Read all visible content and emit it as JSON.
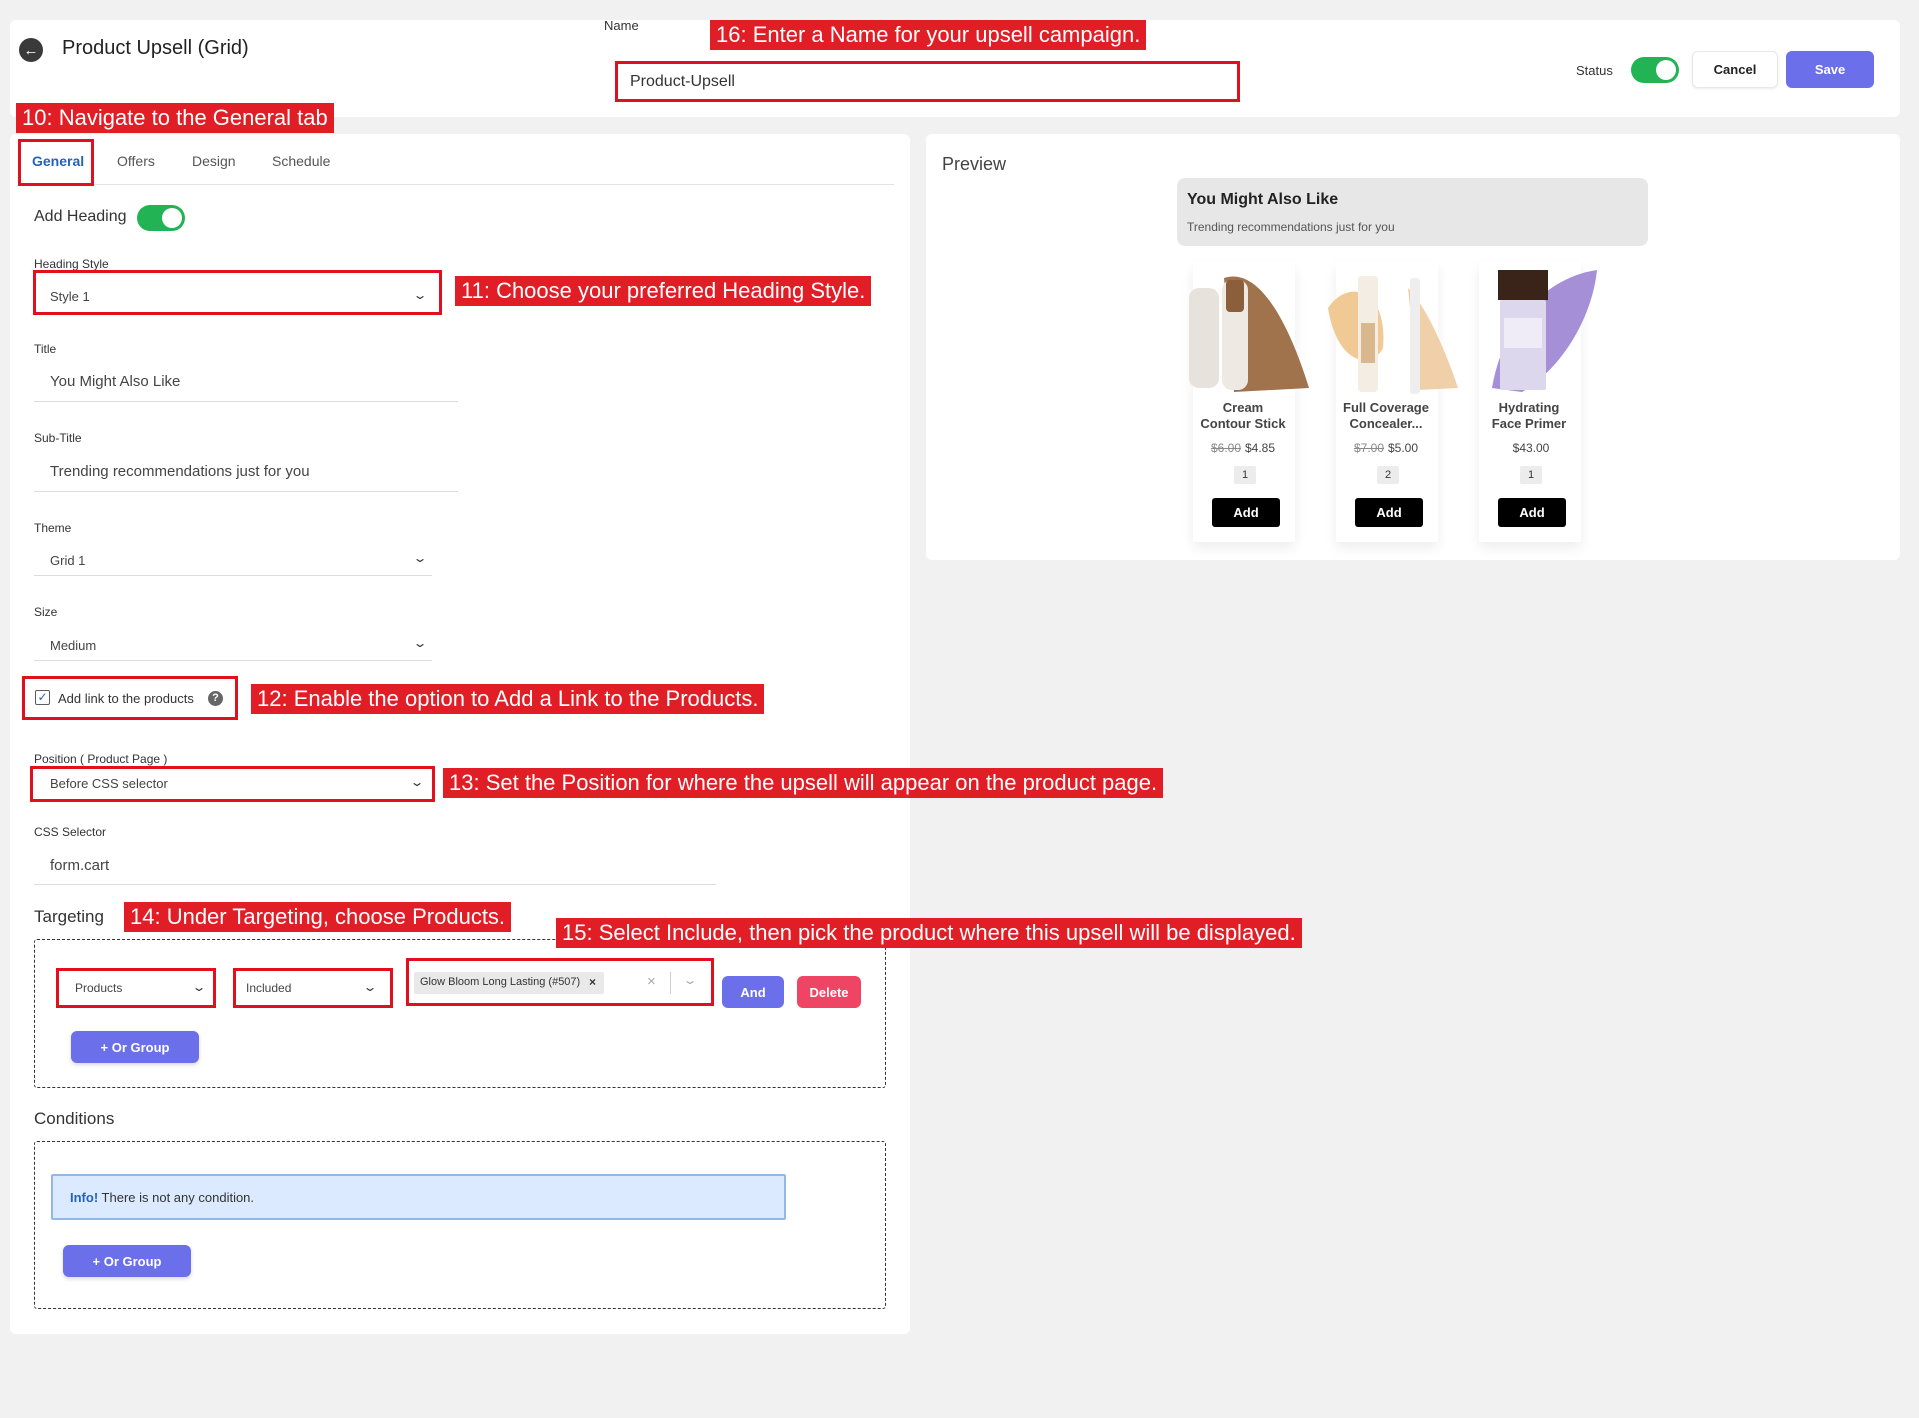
{
  "header": {
    "title": "Product Upsell (Grid)",
    "name_label": "Name",
    "name_value": "Product-Upsell",
    "status_label": "Status",
    "cancel": "Cancel",
    "save": "Save"
  },
  "tabs": [
    "General",
    "Offers",
    "Design",
    "Schedule"
  ],
  "general": {
    "add_heading_label": "Add Heading",
    "heading_style_label": "Heading Style",
    "heading_style_value": "Style 1",
    "title_label": "Title",
    "title_value": "You Might Also Like",
    "subtitle_label": "Sub-Title",
    "subtitle_value": "Trending recommendations just for you",
    "theme_label": "Theme",
    "theme_value": "Grid 1",
    "size_label": "Size",
    "size_value": "Medium",
    "add_link_label": "Add link to the products",
    "add_link_checked": true,
    "position_label": "Position ( Product Page )",
    "position_value": "Before CSS selector",
    "css_selector_label": "CSS Selector",
    "css_selector_value": "form.cart"
  },
  "targeting": {
    "title": "Targeting",
    "type_value": "Products",
    "mode_value": "Included",
    "selected_tag": "Glow Bloom Long Lasting (#507)",
    "and_button": "And",
    "delete_button": "Delete",
    "or_group_button": "+ Or Group"
  },
  "conditions": {
    "title": "Conditions",
    "info_bold": "Info!",
    "info_text": "There is not any condition.",
    "or_group_button": "+ Or Group"
  },
  "preview": {
    "label": "Preview",
    "heading_title": "You Might Also Like",
    "heading_subtitle": "Trending recommendations just for you",
    "products": [
      {
        "name_line1": "Cream",
        "name_line2": "Contour Stick",
        "old_price": "$6.00",
        "price": "$4.85",
        "qty": "1",
        "add": "Add"
      },
      {
        "name_line1": "Full Coverage",
        "name_line2": "Concealer...",
        "old_price": "$7.00",
        "price": "$5.00",
        "qty": "2",
        "add": "Add"
      },
      {
        "name_line1": "Hydrating",
        "name_line2": "Face Primer",
        "old_price": "",
        "price": "$43.00",
        "qty": "1",
        "add": "Add"
      }
    ]
  },
  "callouts": {
    "c10": "10: Navigate to the General tab",
    "c11": "11: Choose your preferred Heading Style.",
    "c12": "12: Enable the option to Add a Link to the Products.",
    "c13": "13: Set the Position for where the upsell will appear on the product page.",
    "c14": "14: Under Targeting, choose Products.",
    "c15": "15: Select Include, then pick the product where this upsell will be displayed.",
    "c16": "16: Enter a Name for your upsell campaign."
  },
  "colors": {
    "accent": "#6b6fea",
    "toggle_on": "#22b454",
    "callout_red": "#e11d26",
    "delete_red": "#ef4564",
    "tab_active": "#2563b8"
  }
}
